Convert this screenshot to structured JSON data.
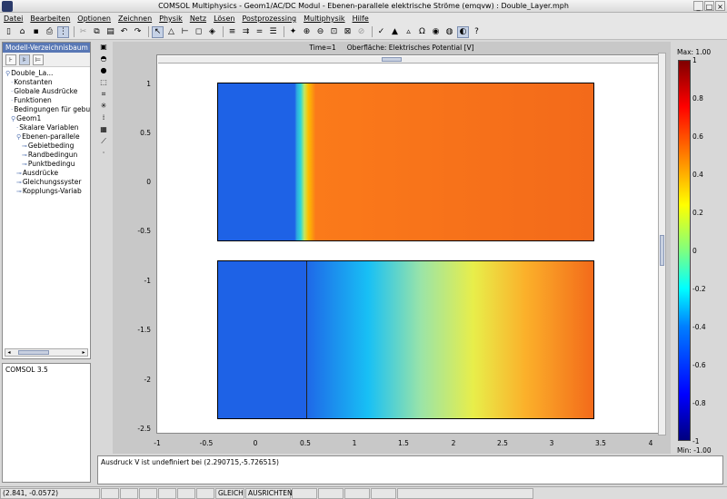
{
  "window": {
    "title": "COMSOL Multiphysics - Geom1/AC/DC Modul - Ebenen-parallele elektrische Ströme (emqvw) : Double_Layer.mph"
  },
  "menu": [
    "Datei",
    "Bearbeiten",
    "Optionen",
    "Zeichnen",
    "Physik",
    "Netz",
    "Lösen",
    "Postprozessing",
    "Multiphysik",
    "Hilfe"
  ],
  "left_panel": {
    "header": "Modell-Verzeichnisbaum",
    "tree": [
      {
        "label": "Double_La...",
        "icon": "tree-root-icon",
        "indent": 0
      },
      {
        "label": "Konstanten",
        "icon": "",
        "indent": 1
      },
      {
        "label": "Globale Ausdrücke",
        "icon": "",
        "indent": 1
      },
      {
        "label": "Funktionen",
        "icon": "",
        "indent": 1
      },
      {
        "label": "Bedingungen für gebu",
        "icon": "",
        "indent": 1
      },
      {
        "label": "Geom1",
        "icon": "tree-expand-icon",
        "indent": 1
      },
      {
        "label": "Skalare Variablen",
        "icon": "",
        "indent": 2
      },
      {
        "label": "Ebenen-parallele",
        "icon": "tree-expand-icon",
        "indent": 2
      },
      {
        "label": "Gebietbeding",
        "icon": "tree-link-icon",
        "indent": 3
      },
      {
        "label": "Randbedingun",
        "icon": "tree-link-icon",
        "indent": 3
      },
      {
        "label": "Punktbedingu",
        "icon": "tree-link-icon",
        "indent": 3
      },
      {
        "label": "Ausdrücke",
        "icon": "tree-link-icon",
        "indent": 2
      },
      {
        "label": "Gleichungssyster",
        "icon": "tree-link-icon",
        "indent": 2
      },
      {
        "label": "Kopplungs-Variab",
        "icon": "tree-link-icon",
        "indent": 2
      }
    ]
  },
  "log_panel": {
    "text": "COMSOL 3.5"
  },
  "plot": {
    "header": "Time=1     Oberfläche: Elektrisches Potential [V]",
    "y_ticks": [
      "1",
      "0.5",
      "0",
      "-0.5",
      "-1",
      "-1.5",
      "-2",
      "-2.5"
    ],
    "x_ticks": [
      "-1",
      "-0.5",
      "0",
      "0.5",
      "1",
      "1.5",
      "2",
      "2.5",
      "3",
      "3.5",
      "4"
    ]
  },
  "colorbar": {
    "max_label": "Max: 1.00",
    "min_label": "Min: -1.00",
    "ticks": [
      "1",
      "0.8",
      "0.6",
      "0.4",
      "0.2",
      "0",
      "-0.2",
      "-0.4",
      "-0.6",
      "-0.8",
      "-1"
    ]
  },
  "messages": {
    "text": "Ausdruck V ist undefiniert bei (2.290715,-5.726515)"
  },
  "statusbar": {
    "coords": "(2.841, -0.0572)",
    "fields": [
      "",
      "",
      "",
      "",
      "",
      "",
      "GLEICH",
      "AUSRICHTEN",
      "",
      "",
      "",
      "",
      ""
    ]
  }
}
